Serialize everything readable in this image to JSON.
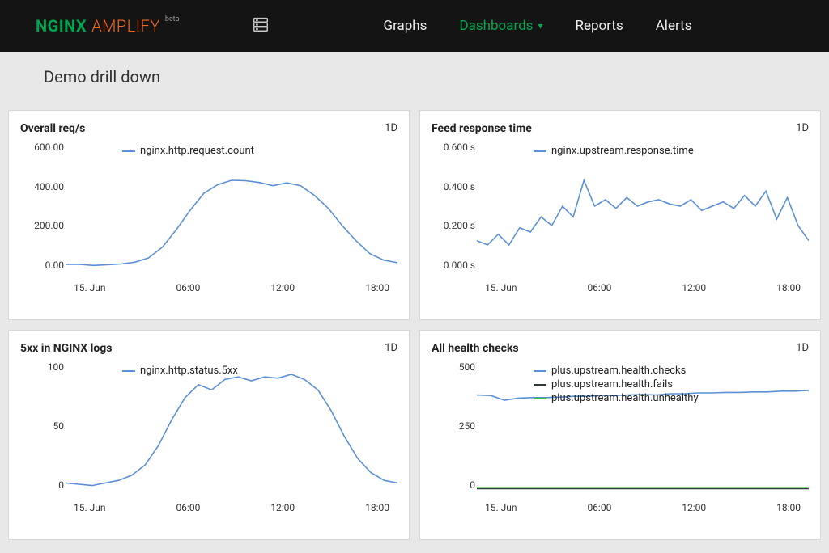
{
  "brand": {
    "nginx": "NGINX",
    "amplify": "AMPLIFY",
    "beta": "beta"
  },
  "nav": {
    "graphs": "Graphs",
    "dashboards": "Dashboards",
    "reports": "Reports",
    "alerts": "Alerts"
  },
  "page_title": "Demo drill down",
  "colors": {
    "series_blue": "#5b8fd6",
    "series_dark": "#2f3a3a",
    "series_green": "#3fbf3f"
  },
  "panels": {
    "overall": {
      "title": "Overall req/s",
      "range": "1D"
    },
    "feed": {
      "title": "Feed response time",
      "range": "1D"
    },
    "fivexx": {
      "title": "5xx in NGINX logs",
      "range": "1D"
    },
    "health": {
      "title": "All health checks",
      "range": "1D"
    }
  },
  "chart_data": [
    {
      "id": "overall",
      "type": "line",
      "title": "Overall req/s",
      "ylabel": "",
      "ylim": [
        0,
        600
      ],
      "y_ticks": [
        "600.00",
        "400.00",
        "200.00",
        "0.00"
      ],
      "x_ticks": [
        "15. Jun",
        "06:00",
        "12:00",
        "18:00"
      ],
      "series": [
        {
          "name": "nginx.http.request.count",
          "color": "#5b8fd6",
          "values": [
            30,
            30,
            25,
            28,
            32,
            40,
            60,
            110,
            190,
            280,
            360,
            400,
            420,
            418,
            410,
            395,
            408,
            395,
            350,
            290,
            210,
            140,
            80,
            50,
            38
          ]
        }
      ]
    },
    {
      "id": "feed",
      "type": "line",
      "title": "Feed response time",
      "ylabel": "s",
      "ylim": [
        0,
        0.6
      ],
      "y_ticks": [
        "0.600 s",
        "0.400 s",
        "0.200 s",
        "0.000 s"
      ],
      "x_ticks": [
        "15. Jun",
        "06:00",
        "12:00",
        "18:00"
      ],
      "series": [
        {
          "name": "nginx.upstream.response.time",
          "color": "#5b8fd6",
          "values": [
            0.14,
            0.12,
            0.17,
            0.12,
            0.2,
            0.18,
            0.25,
            0.21,
            0.3,
            0.25,
            0.42,
            0.3,
            0.33,
            0.29,
            0.34,
            0.3,
            0.32,
            0.33,
            0.31,
            0.3,
            0.33,
            0.28,
            0.3,
            0.32,
            0.29,
            0.35,
            0.3,
            0.37,
            0.24,
            0.34,
            0.21,
            0.14
          ]
        }
      ]
    },
    {
      "id": "fivexx",
      "type": "line",
      "title": "5xx in NGINX logs",
      "ylabel": "",
      "ylim": [
        0,
        100
      ],
      "y_ticks": [
        "100",
        "50",
        "0"
      ],
      "x_ticks": [
        "15. Jun",
        "06:00",
        "12:00",
        "18:00"
      ],
      "series": [
        {
          "name": "nginx.http.status.5xx",
          "color": "#5b8fd6",
          "values": [
            6,
            5,
            4,
            6,
            8,
            12,
            20,
            35,
            55,
            72,
            82,
            78,
            86,
            88,
            85,
            88,
            87,
            90,
            86,
            78,
            62,
            42,
            25,
            14,
            8,
            6
          ]
        }
      ]
    },
    {
      "id": "health",
      "type": "line",
      "title": "All health checks",
      "ylabel": "",
      "ylim": [
        0,
        500
      ],
      "y_ticks": [
        "500",
        "250",
        "0"
      ],
      "x_ticks": [
        "15. Jun",
        "06:00",
        "12:00",
        "18:00"
      ],
      "series": [
        {
          "name": "plus.upstream.health.checks",
          "color": "#5b8fd6",
          "values": [
            370,
            368,
            350,
            358,
            360,
            360,
            362,
            365,
            365,
            368,
            368,
            370,
            372,
            370,
            375,
            375,
            378,
            378,
            380,
            380,
            382,
            382,
            385,
            385,
            388
          ]
        },
        {
          "name": "plus.upstream.health.fails",
          "color": "#2f3a3a",
          "values": [
            8,
            8,
            8,
            8,
            8,
            8,
            8,
            8,
            8,
            8,
            8,
            8,
            8,
            8,
            8,
            8,
            8,
            8,
            8,
            8,
            8,
            8,
            8,
            8,
            8
          ]
        },
        {
          "name": "plus.upstream.health.unhealthy",
          "color": "#3fbf3f",
          "values": [
            12,
            12,
            12,
            12,
            12,
            12,
            12,
            12,
            12,
            12,
            12,
            12,
            12,
            12,
            12,
            12,
            12,
            12,
            12,
            12,
            12,
            12,
            12,
            12,
            12
          ]
        }
      ]
    }
  ]
}
